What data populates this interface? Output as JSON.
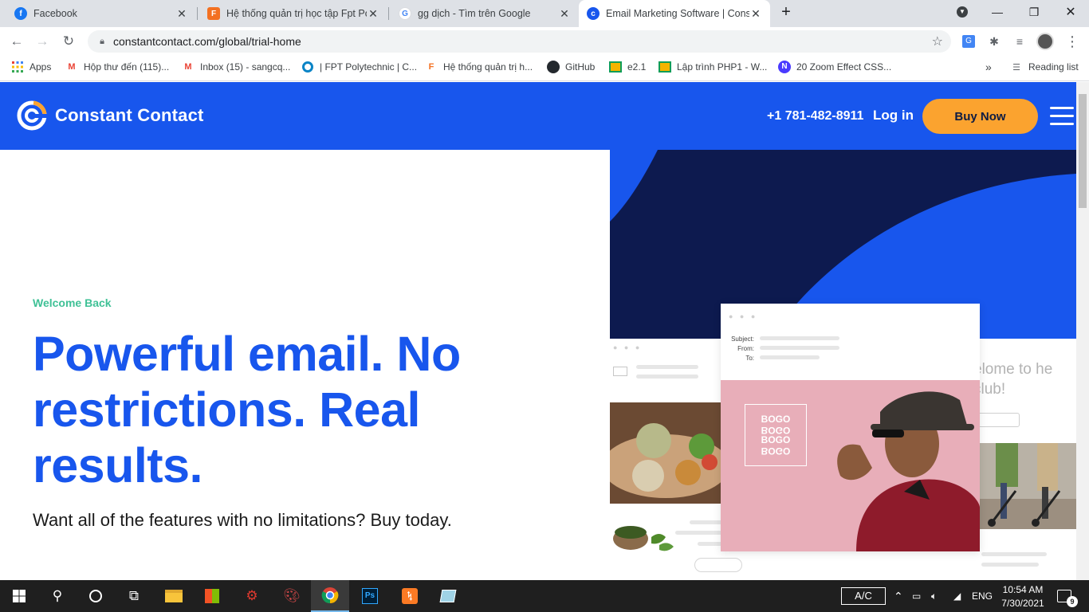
{
  "browser": {
    "tabs": [
      {
        "title": "Facebook",
        "icon": "facebook-icon"
      },
      {
        "title": "Hệ thống quản trị học tập Fpt Po",
        "icon": "fpt-icon"
      },
      {
        "title": "gg dịch - Tìm trên Google",
        "icon": "google-icon"
      },
      {
        "title": "Email Marketing Software | Const",
        "icon": "constant-contact-icon",
        "active": true
      }
    ],
    "new_tab": "+",
    "url": "constantcontact.com/global/trial-home",
    "bookmarks": [
      {
        "label": "Apps",
        "icon": "apps-grid-icon"
      },
      {
        "label": "Hộp thư đến (115)...",
        "icon": "gmail-icon"
      },
      {
        "label": "Inbox (15) - sangcq...",
        "icon": "gmail-icon"
      },
      {
        "label": "| FPT Polytechnic | C...",
        "icon": "circle-icon"
      },
      {
        "label": "Hệ thống quản trị h...",
        "icon": "fpt-icon"
      },
      {
        "label": "GitHub",
        "icon": "github-icon"
      },
      {
        "label": "e2.1",
        "icon": "classroom-icon"
      },
      {
        "label": "Lập trình PHP1 - W...",
        "icon": "classroom-icon"
      },
      {
        "label": "20 Zoom Effect CSS...",
        "icon": "n-icon"
      }
    ],
    "more_bookmarks": "»",
    "reading_list": "Reading list"
  },
  "site": {
    "brand": "Constant Contact",
    "phone": "+1 781-482-8911",
    "login": "Log in",
    "buy_now": "Buy Now",
    "eyebrow": "Welcome Back",
    "headline": "Powerful email. No restrictions. Real results.",
    "subtext": "Want all of the features with no limitations? Buy today.",
    "mock": {
      "subject_label": "Subject:",
      "from_label": "From:",
      "to_label": "To:",
      "bogo": [
        "BOGO",
        "BOGO",
        "BOGO",
        "BOGO"
      ],
      "club_text": "elome to he club!"
    },
    "colors": {
      "brand_blue": "#1856ed",
      "navy": "#0d1a4f",
      "accent_orange": "#fba32f",
      "eyebrow_green": "#3fc196"
    }
  },
  "taskbar": {
    "ime": "A/C",
    "lang": "ENG",
    "time": "10:54 AM",
    "date": "7/30/2021",
    "notifications": "9"
  }
}
